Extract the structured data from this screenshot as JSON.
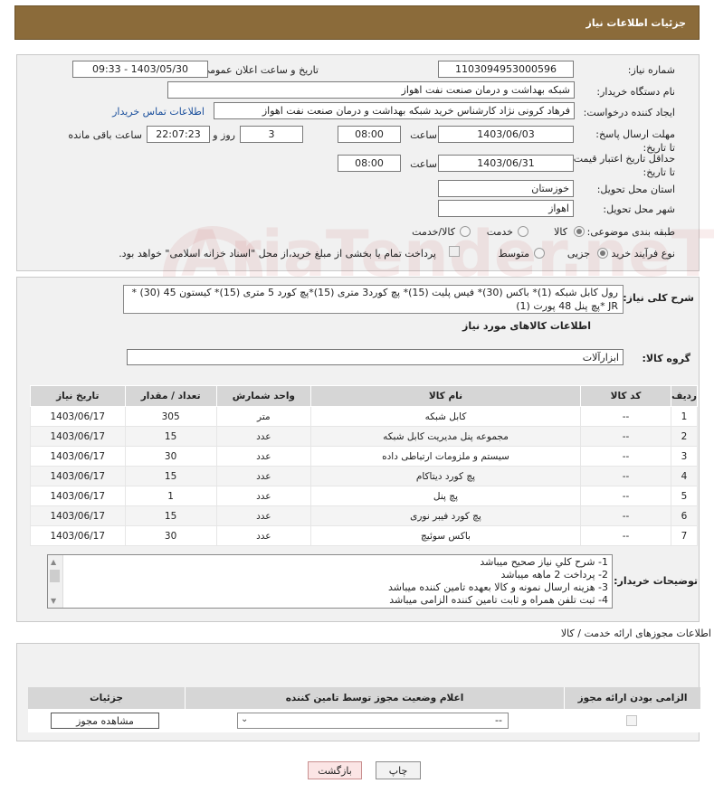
{
  "header": {
    "title": "جزئیات اطلاعات نیاز"
  },
  "form": {
    "need_number_label": "شماره نیاز:",
    "need_number": "1103094953000596",
    "announce_label": "تاریخ و ساعت اعلان عمومی:",
    "announce_value": "1403/05/30 - 09:33",
    "buyer_label": "نام دستگاه خریدار:",
    "buyer_value": "شبکه بهداشت و درمان صنعت نفت اهواز",
    "creator_label": "ایجاد کننده درخواست:",
    "creator_value": "فرهاد کرونی نژاد کارشناس خرید شبکه بهداشت و درمان صنعت نفت اهواز",
    "contact_link": "اطلاعات تماس خریدار",
    "deadline_label": "مهلت ارسال پاسخ: تا تاریخ:",
    "deadline_date": "1403/06/03",
    "time_label": "ساعت",
    "deadline_time": "08:00",
    "days_value": "3",
    "days_label": "روز و",
    "remaining_time": "22:07:23",
    "remaining_label": "ساعت باقی مانده",
    "validity_label": "حداقل تاریخ اعتبار قیمت: تا تاریخ:",
    "validity_date": "1403/06/31",
    "validity_time": "08:00",
    "province_label": "استان محل تحویل:",
    "province_value": "خوزستان",
    "city_label": "شهر محل تحویل:",
    "city_value": "اهواز",
    "category_label": "طبقه بندی موضوعی:",
    "category_options": [
      "کالا",
      "خدمت",
      "کالا/خدمت"
    ],
    "category_selected": "کالا",
    "process_label": "نوع فرآیند خرید :",
    "process_options": [
      "جزیی",
      "متوسط"
    ],
    "process_selected": "جزیی",
    "payment_note": "پرداخت تمام یا بخشی از مبلغ خرید،از محل \"اسناد خزانه اسلامی\" خواهد بود."
  },
  "summary": {
    "label": "شرح کلی نیاز:",
    "text": "رول کابل شبکه (1)* باکس (30)* فیس پلیت (15)* پچ کورد3 متری (15)*پچ کورد 5 متری (15)* کیستون 45 (30) * JR *پچ پنل 48 پورت (1)"
  },
  "goods": {
    "section_title": "اطلاعات کالاهای مورد نیاز",
    "group_label": "گروه کالا:",
    "group_value": "ابزارآلات",
    "columns": [
      "ردیف",
      "کد کالا",
      "نام کالا",
      "واحد شمارش",
      "تعداد / مقدار",
      "تاریخ نیاز"
    ],
    "rows": [
      {
        "idx": "1",
        "code": "--",
        "name": "کابل شبکه",
        "unit": "متر",
        "qty": "305",
        "date": "1403/06/17"
      },
      {
        "idx": "2",
        "code": "--",
        "name": "مجموعه پنل مدیریت کابل شبکه",
        "unit": "عدد",
        "qty": "15",
        "date": "1403/06/17"
      },
      {
        "idx": "3",
        "code": "--",
        "name": "سیستم و ملزومات ارتباطی داده",
        "unit": "عدد",
        "qty": "30",
        "date": "1403/06/17"
      },
      {
        "idx": "4",
        "code": "--",
        "name": "پچ کورد دیتاکام",
        "unit": "عدد",
        "qty": "15",
        "date": "1403/06/17"
      },
      {
        "idx": "5",
        "code": "--",
        "name": "پچ پنل",
        "unit": "عدد",
        "qty": "1",
        "date": "1403/06/17"
      },
      {
        "idx": "6",
        "code": "--",
        "name": "پچ کورد فیبر نوری",
        "unit": "عدد",
        "qty": "15",
        "date": "1403/06/17"
      },
      {
        "idx": "7",
        "code": "--",
        "name": "باکس سوئیچ",
        "unit": "عدد",
        "qty": "30",
        "date": "1403/06/17"
      }
    ]
  },
  "buyer_notes": {
    "label": "توضیحات خریدار:",
    "lines": [
      "1- شرح کلي نياز صحيح ميباشد",
      "2- پرداخت 2 ماهه ميباشد",
      "3- هزينه ارسال نمونه و کالا بعهده تامين کننده ميباشد",
      "4- ثبت تلفن همراه و ثابت تامين کننده الزامی ميباشد"
    ]
  },
  "permits": {
    "section_title": "اطلاعات مجوزهای ارائه خدمت / کالا",
    "columns": [
      "الزامی بودن ارائه مجوز",
      "اعلام وضعیت مجوز توسط تامین کننده",
      "جزئیات"
    ],
    "select_value": "--",
    "view_button": "مشاهده مجوز"
  },
  "footer": {
    "print_button": "چاپ",
    "back_button": "بازگشت"
  },
  "watermark": "AriaTender.neT"
}
